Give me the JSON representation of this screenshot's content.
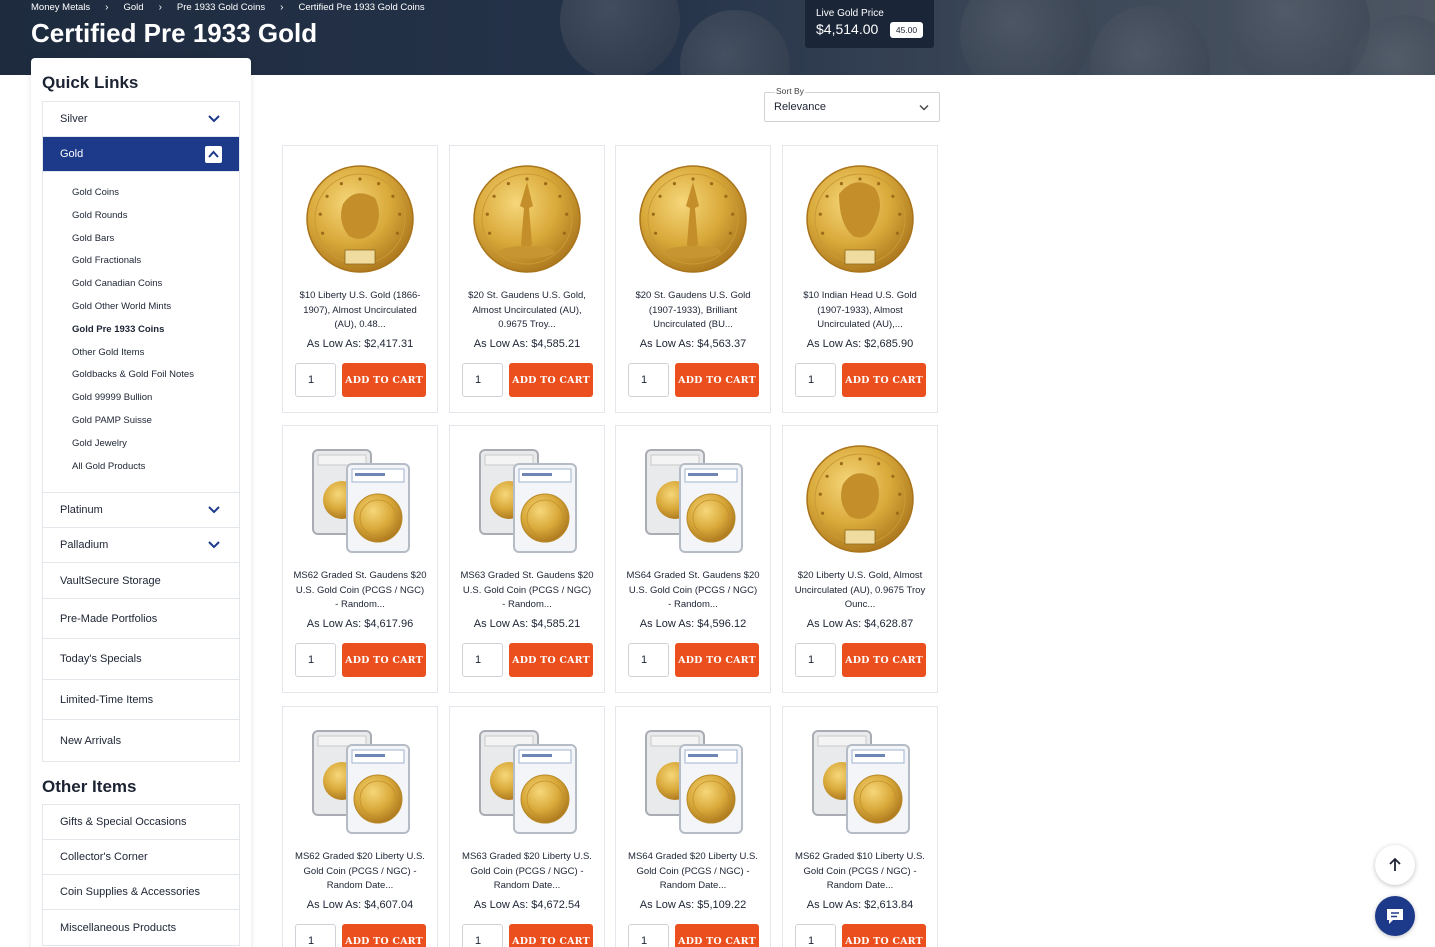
{
  "breadcrumb": [
    "Money Metals",
    "Gold",
    "Pre 1933 Gold Coins",
    "Certified Pre 1933 Gold Coins"
  ],
  "page_title": "Certified Pre 1933 Gold",
  "live_price": {
    "label": "Live Gold Price",
    "value": "$4,514.00",
    "change": "45.00"
  },
  "sidebar": {
    "quick_links_heading": "Quick Links",
    "silver": "Silver",
    "gold": "Gold",
    "gold_submenu": [
      "Gold Coins",
      "Gold Rounds",
      "Gold Bars",
      "Gold Fractionals",
      "Gold Canadian Coins",
      "Gold Other World Mints",
      "Gold Pre 1933 Coins",
      "Other Gold Items",
      "Goldbacks & Gold Foil Notes",
      "Gold 99999 Bullion",
      "Gold PAMP Suisse",
      "Gold Jewelry",
      "All Gold Products"
    ],
    "platinum": "Platinum",
    "palladium": "Palladium",
    "vault": "VaultSecure Storage",
    "premade": "Pre-Made Portfolios",
    "specials": "Today's Specials",
    "limited": "Limited-Time Items",
    "arrivals": "New Arrivals",
    "other_heading": "Other Items",
    "other_items": [
      "Gifts & Special Occasions",
      "Collector's Corner",
      "Coin Supplies & Accessories",
      "Miscellaneous Products"
    ]
  },
  "sort": {
    "label": "Sort By",
    "value": "Relevance"
  },
  "add_label": "ADD TO CART",
  "products": [
    {
      "name": "$10 Liberty U.S. Gold (1866-1907), Almost Uncirculated (AU), 0.48...",
      "price": "As Low As: $2,417.31",
      "qty": "1",
      "img": "liberty-coin"
    },
    {
      "name": "$20 St. Gaudens U.S. Gold, Almost Uncirculated (AU), 0.9675 Troy...",
      "price": "As Low As: $4,585.21",
      "qty": "1",
      "img": "stgaudens-coin"
    },
    {
      "name": "$20 St. Gaudens U.S. Gold (1907-1933), Brilliant Uncirculated (BU...",
      "price": "As Low As: $4,563.37",
      "qty": "1",
      "img": "stgaudens-coin"
    },
    {
      "name": "$10 Indian Head U.S. Gold (1907-1933), Almost Uncirculated (AU),...",
      "price": "As Low As: $2,685.90",
      "qty": "1",
      "img": "indian-coin"
    },
    {
      "name": "MS62 Graded St. Gaudens $20 U.S. Gold Coin (PCGS / NGC) - Random...",
      "price": "As Low As: $4,617.96",
      "qty": "1",
      "img": "slab"
    },
    {
      "name": "MS63 Graded St. Gaudens $20 U.S. Gold Coin (PCGS / NGC) - Random...",
      "price": "As Low As: $4,585.21",
      "qty": "1",
      "img": "slab"
    },
    {
      "name": "MS64 Graded St. Gaudens $20 U.S. Gold Coin (PCGS / NGC) - Random...",
      "price": "As Low As: $4,596.12",
      "qty": "1",
      "img": "slab"
    },
    {
      "name": "$20 Liberty U.S. Gold, Almost Uncirculated (AU), 0.9675 Troy Ounc...",
      "price": "As Low As: $4,628.87",
      "qty": "1",
      "img": "liberty-coin"
    },
    {
      "name": "MS62 Graded $20 Liberty U.S. Gold Coin (PCGS / NGC) - Random Date...",
      "price": "As Low As: $4,607.04",
      "qty": "1",
      "img": "slab"
    },
    {
      "name": "MS63 Graded $20 Liberty U.S. Gold Coin (PCGS / NGC) - Random Date...",
      "price": "As Low As: $4,672.54",
      "qty": "1",
      "img": "slab"
    },
    {
      "name": "MS64 Graded $20 Liberty U.S. Gold Coin (PCGS / NGC) - Random Date...",
      "price": "As Low As: $5,109.22",
      "qty": "1",
      "img": "slab"
    },
    {
      "name": "MS62 Graded $10 Liberty U.S. Gold Coin (PCGS / NGC) - Random Date...",
      "price": "As Low As: $2,613.84",
      "qty": "1",
      "img": "slab"
    }
  ],
  "colors": {
    "brand": "#1d3a8a",
    "accent": "#ea4f1d",
    "hero": "#1e2b3f"
  }
}
